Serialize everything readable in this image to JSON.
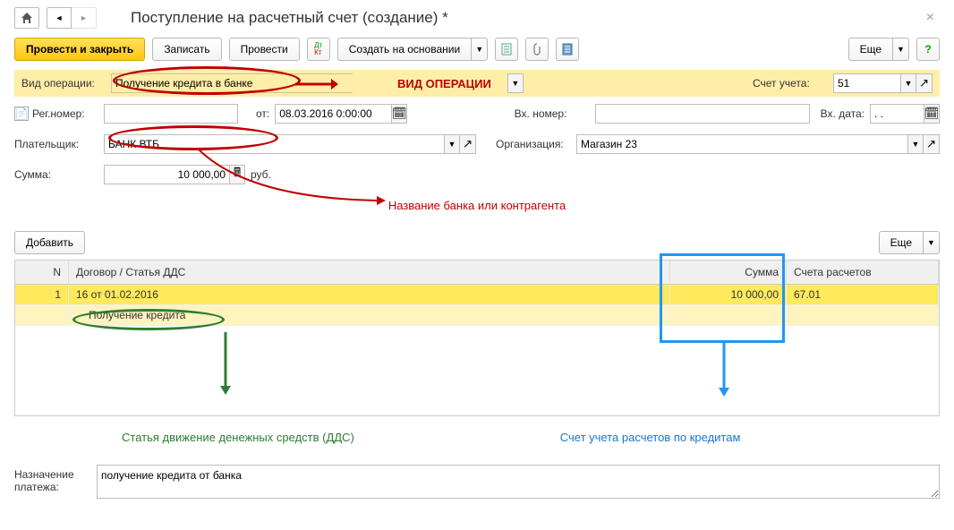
{
  "title": "Поступление на расчетный счет (создание) *",
  "toolbar": {
    "post_close": "Провести и закрыть",
    "save": "Записать",
    "post": "Провести",
    "create_based": "Создать на основании",
    "more": "Еще"
  },
  "labels": {
    "op_type": "Вид операции:",
    "reg_no": "Рег.номер:",
    "from": "от:",
    "payer": "Плательщик:",
    "sum": "Сумма:",
    "currency": "руб.",
    "account": "Счет учета:",
    "in_no": "Вх. номер:",
    "in_date": "Вх. дата:",
    "org": "Организация:",
    "purpose": "Назначение платежа:",
    "add": "Добавить"
  },
  "fields": {
    "op_type": "Получение кредита в банке",
    "reg_no": "",
    "date": "08.03.2016 0:00:00",
    "payer": "БАНК ВТБ",
    "sum": "10 000,00",
    "account": "51",
    "in_no": "",
    "in_date": ". .",
    "org": "Магазин 23",
    "purpose": "получение кредита от банка"
  },
  "annotations": {
    "op_type": "ВИД ОПЕРАЦИИ",
    "bank_name": "Название банка или контрагента",
    "dds": "Статья движение денежных средств (ДДС)",
    "acc": "Счет учета расчетов по кредитам"
  },
  "table": {
    "headers": {
      "n": "N",
      "desc": "Договор / Статья ДДС",
      "sum": "Сумма",
      "acc": "Счета расчетов"
    },
    "row": {
      "n": "1",
      "contract": "16 от 01.02.2016",
      "dds": "Получение кредита",
      "sum": "10 000,00",
      "acc": "67.01"
    }
  }
}
